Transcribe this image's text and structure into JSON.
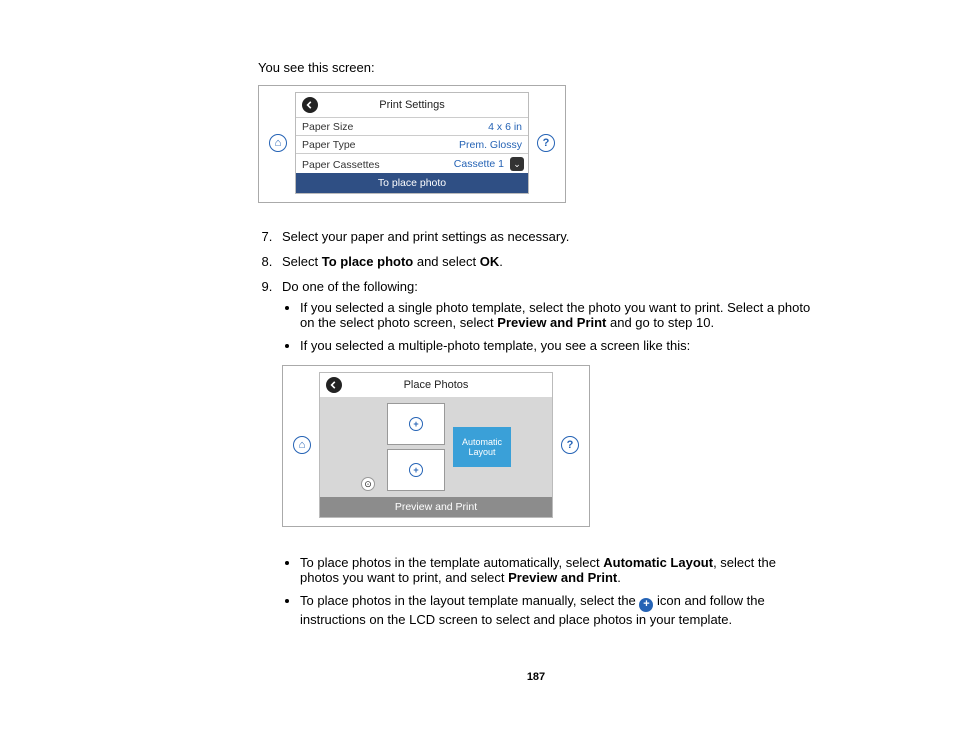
{
  "intro": "You see this screen:",
  "fig1": {
    "title": "Print Settings",
    "rows": {
      "size_label": "Paper Size",
      "size_value": "4 x 6 in",
      "type_label": "Paper Type",
      "type_value": "Prem. Glossy",
      "cass_label": "Paper Cassettes",
      "cass_value": "Cassette 1"
    },
    "footer": "To place photo"
  },
  "steps": {
    "s7": "Select your paper and print settings as necessary.",
    "s8a": "Select ",
    "s8b": "To place photo",
    "s8c": " and select ",
    "s8d": "OK",
    "s8e": ".",
    "s9": "Do one of the following:",
    "b1a": "If you selected a single photo template, select the photo you want to print. Select a photo on the select photo screen, select ",
    "b1b": "Preview and Print",
    "b1c": " and go to step 10.",
    "b2": "If you selected a multiple-photo template, you see a screen like this:"
  },
  "fig2": {
    "title": "Place Photos",
    "auto": "Automatic Layout",
    "footer": "Preview and Print"
  },
  "post": {
    "p1a": "To place photos in the template automatically, select ",
    "p1b": "Automatic Layout",
    "p1c": ", select the photos you want to print, and select ",
    "p1d": "Preview and Print",
    "p1e": ".",
    "p2a": "To place photos in the layout template manually, select the ",
    "p2b": " icon and follow the instructions on the LCD screen to select and place photos in your template."
  },
  "page_number": "187"
}
